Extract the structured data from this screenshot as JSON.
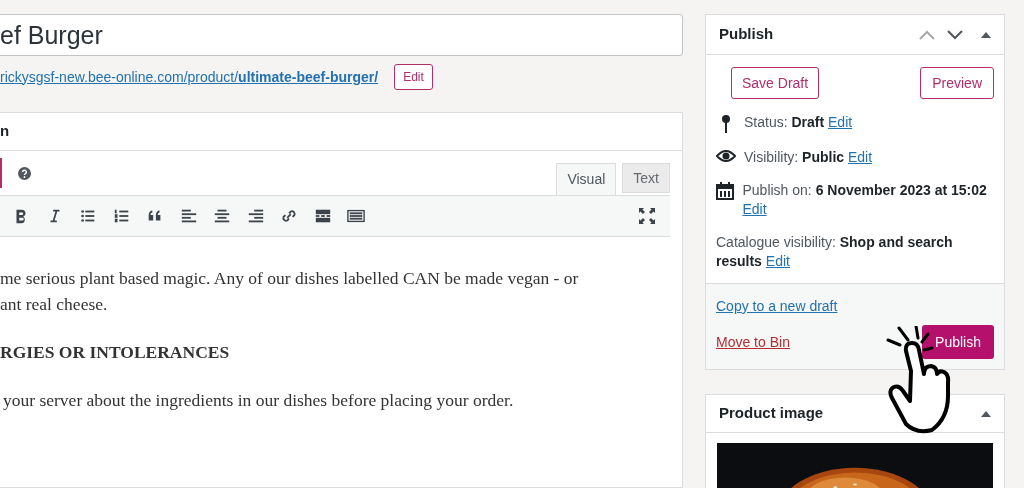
{
  "title_field": {
    "value": "ef Burger"
  },
  "permalink": {
    "url_base": "rickysgsf-new.bee-online.com/product/",
    "slug": "ultimate-beef-burger/",
    "edit_button": "Edit"
  },
  "editor": {
    "heading": "n",
    "tabs": [
      {
        "label": "Visual",
        "selected": true
      },
      {
        "label": "Text",
        "selected": false
      }
    ],
    "content": [
      {
        "kind": "paragraph",
        "lines": [
          "me serious plant based magic. Any of our dishes labelled CAN be made vegan - or",
          "ant real cheese."
        ]
      },
      {
        "kind": "heading",
        "lines": [
          "RGIES OR INTOLERANCES"
        ]
      },
      {
        "kind": "paragraph",
        "lines": [
          "your server about the ingredients in our dishes before placing your order."
        ]
      }
    ]
  },
  "publish": {
    "title": "Publish",
    "save_draft": "Save Draft",
    "preview": "Preview",
    "rows": [
      {
        "kind": "status",
        "text": "Status: **Draft**",
        "link": "Edit"
      },
      {
        "kind": "visibility",
        "text": "Visibility: **Public**",
        "link": "Edit"
      },
      {
        "kind": "schedule",
        "text": "Publish on: **6 November 2023 at 15:02**",
        "link": "Edit"
      },
      {
        "kind": "catalogue",
        "text": "Catalogue visibility: **Shop and search results**",
        "link": "Edit"
      }
    ],
    "copy_link": "Copy to a new draft",
    "bin_link": "Move to Bin",
    "publish_button": "Publish"
  },
  "product_image": {
    "title": "Product image"
  }
}
